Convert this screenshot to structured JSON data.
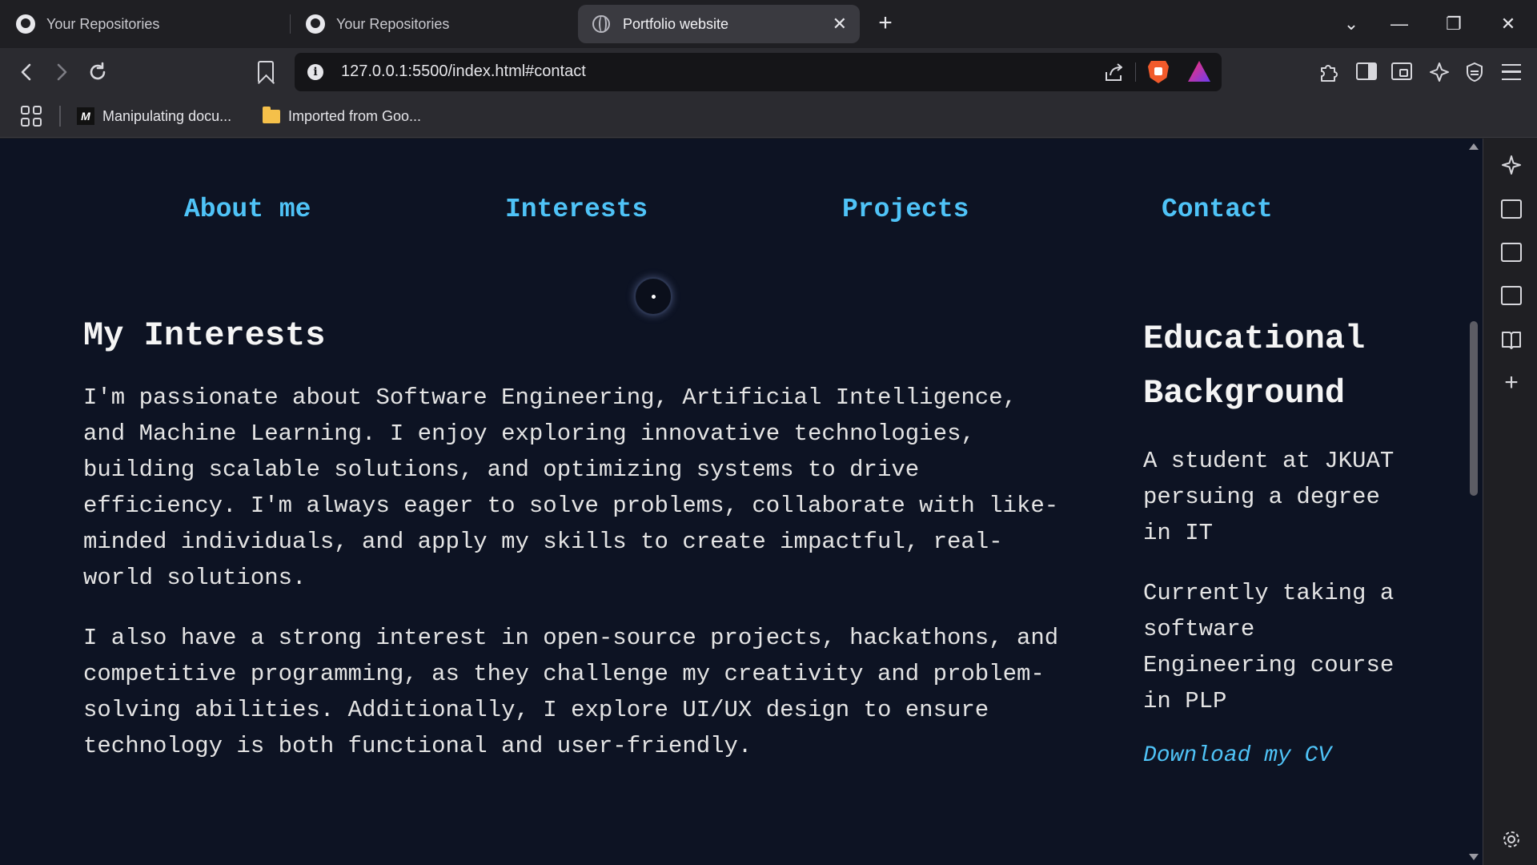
{
  "browser": {
    "tabs": [
      {
        "title": "Your Repositories",
        "icon": "github-icon",
        "active": false
      },
      {
        "title": "Your Repositories",
        "icon": "github-icon",
        "active": false
      },
      {
        "title": "Portfolio website",
        "icon": "globe-icon",
        "active": true
      }
    ],
    "new_tab_glyph": "+",
    "close_glyph": "✕",
    "window_controls": {
      "chevron": "⌄",
      "minimize": "—",
      "restore": "❐",
      "close": "✕"
    },
    "address": "127.0.0.1:5500/index.html#contact",
    "info_glyph": "i",
    "bookmarks": [
      {
        "label": "Manipulating docu...",
        "icon": "mdn-icon",
        "icon_text": "M"
      },
      {
        "label": "Imported from Goo...",
        "icon": "folder-icon"
      }
    ],
    "accent_colors": {
      "brave": "#f15a2b",
      "link": "#4fc3f7",
      "page_bg": "#0d1323"
    }
  },
  "site": {
    "nav": [
      "About me",
      "Interests",
      "Projects",
      "Contact"
    ],
    "interests": {
      "heading": "My Interests",
      "paragraphs": [
        "I'm passionate about Software Engineering, Artificial Intelligence, and Machine Learning. I enjoy exploring innovative technologies, building scalable solutions, and optimizing systems to drive efficiency. I'm always eager to solve problems, collaborate with like-minded individuals, and apply my skills to create impactful, real-world solutions.",
        "I also have a strong interest in open-source projects, hackathons, and competitive programming, as they challenge my creativity and problem-solving abilities. Additionally, I explore UI/UX design to ensure technology is both functional and user-friendly."
      ]
    },
    "education": {
      "heading": "Educational Background",
      "paragraphs": [
        "A student at JKUAT persuing a degree in IT",
        "Currently taking a software Engineering course in PLP"
      ],
      "cv_link": "Download my CV"
    }
  }
}
